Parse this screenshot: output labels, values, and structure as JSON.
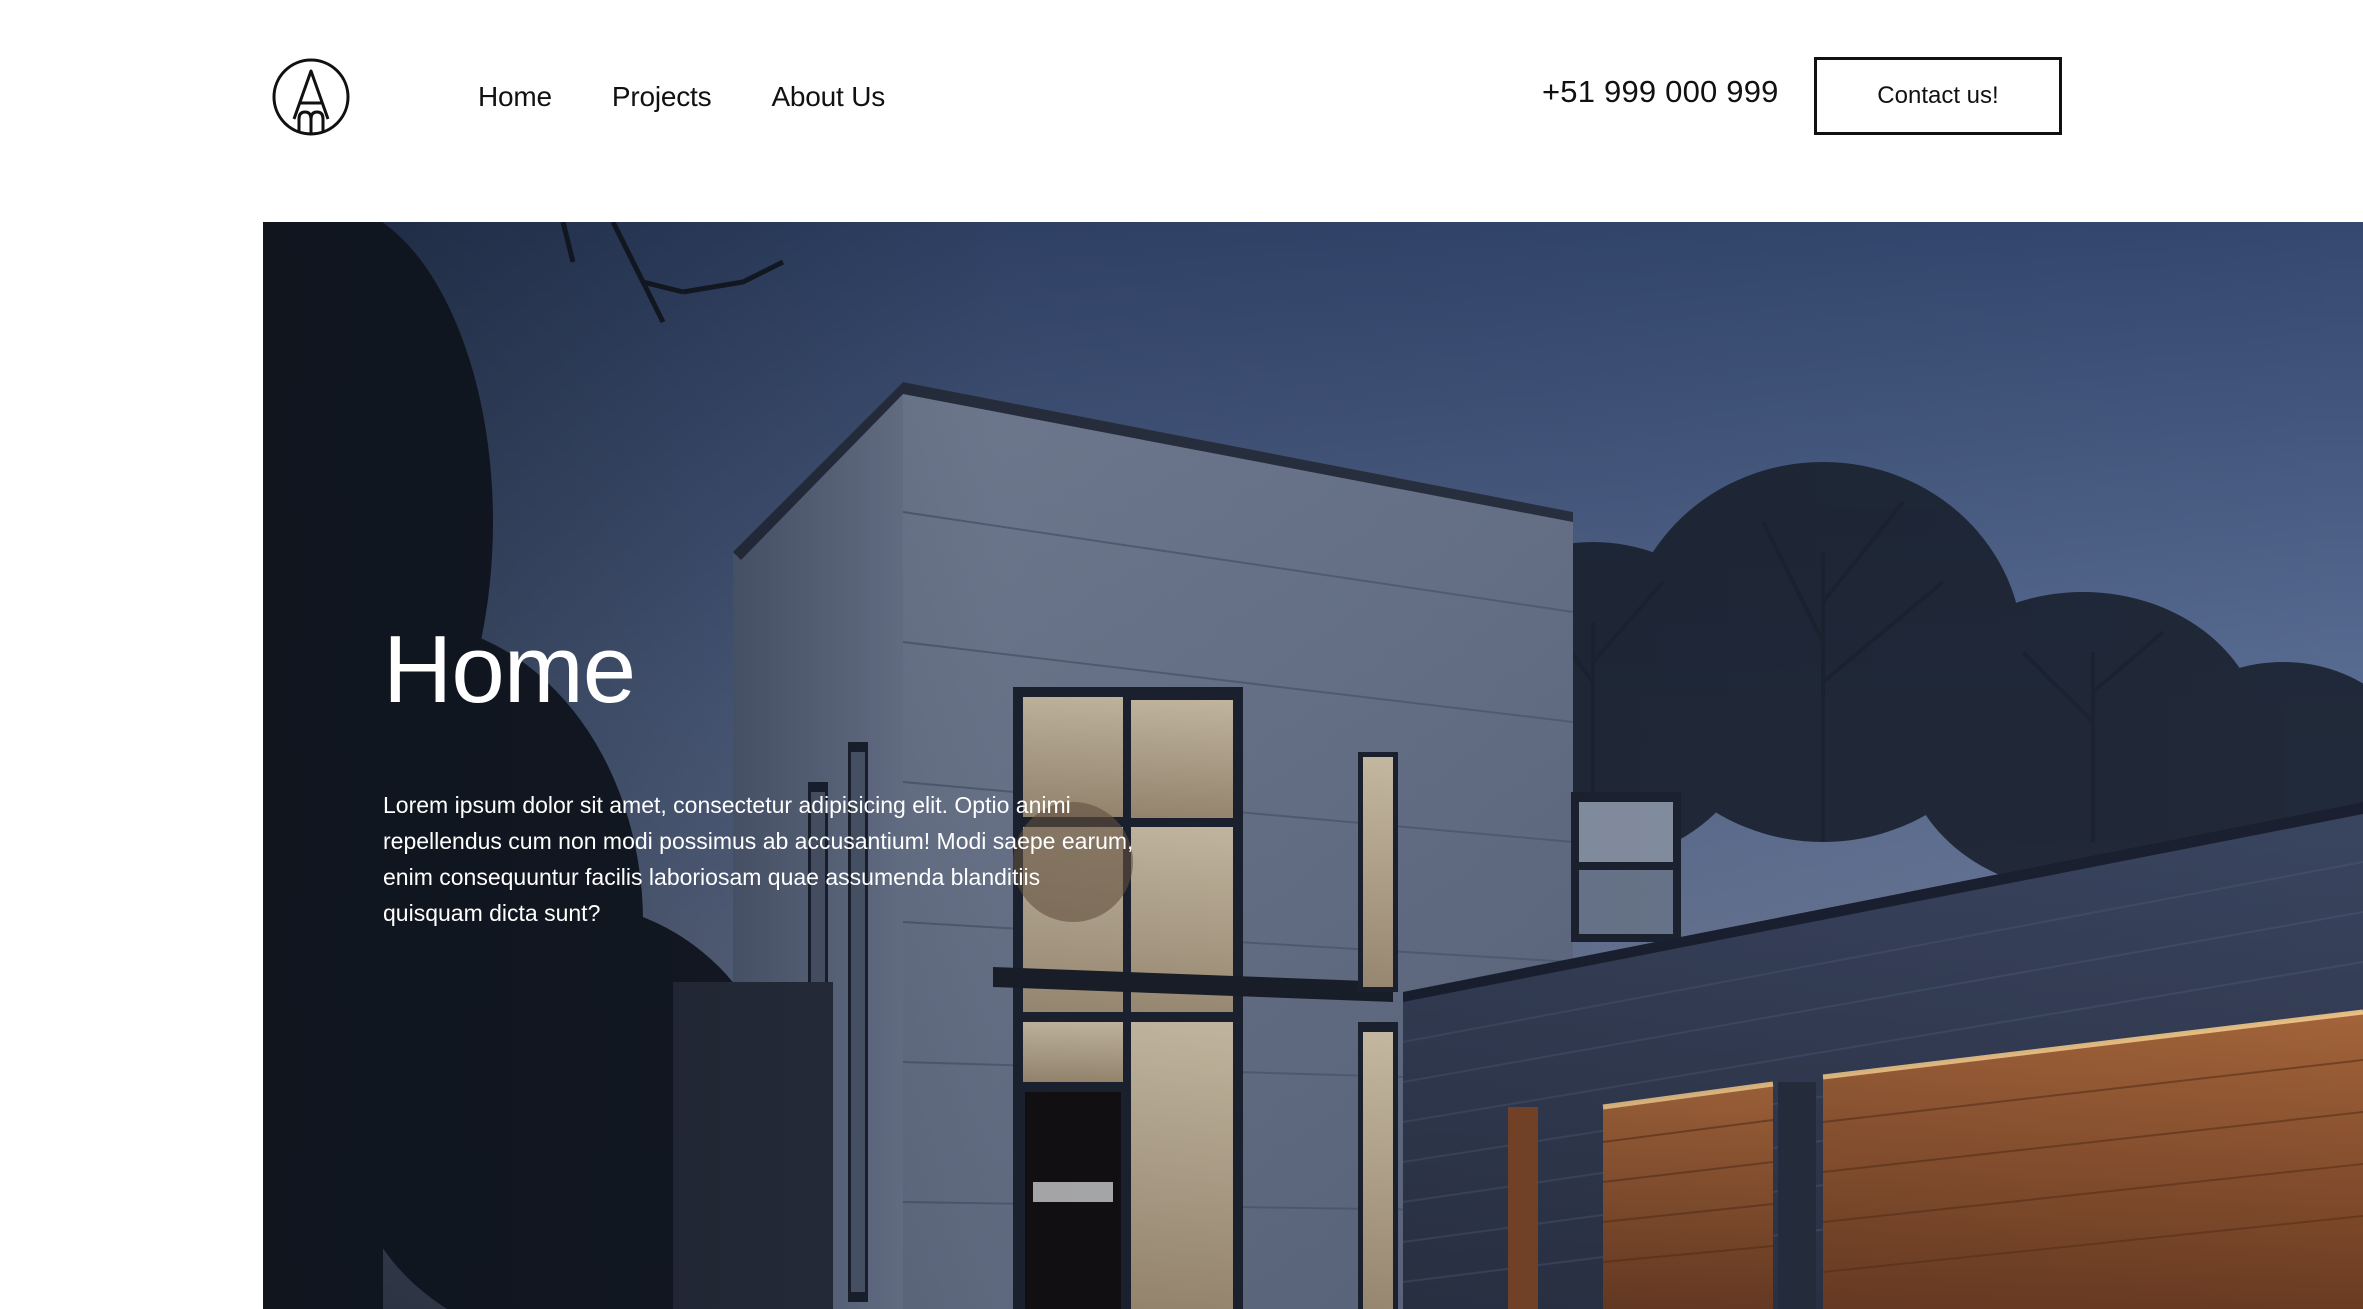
{
  "header": {
    "logo_icon": "architect-monogram-logo-icon",
    "nav": [
      {
        "label": "Home"
      },
      {
        "label": "Projects"
      },
      {
        "label": "About Us"
      }
    ],
    "phone": "+51 999 000 999",
    "contact_label": "Contact us!"
  },
  "hero": {
    "title": "Home",
    "description": "Lorem ipsum dolor sit amet, consectetur adipisicing elit. Optio animi repellendus cum non modi possimus ab accusantium! Modi saepe earum, enim consequuntur facilis laboriosam quae assumenda blanditiis quisquam dicta sunt?",
    "background": "modern-house-at-dusk-photo"
  },
  "colors": {
    "text": "#111111",
    "hero_text": "#ffffff",
    "sky_top": "#3b4f75",
    "wood": "#8a5230"
  }
}
